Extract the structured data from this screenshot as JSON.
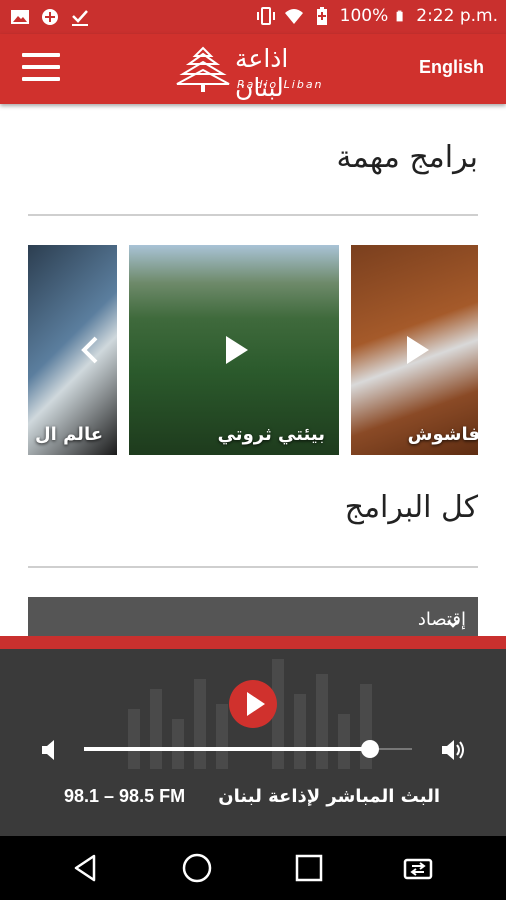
{
  "status_bar": {
    "left_icons": [
      "image-icon",
      "data-saver-icon",
      "download-done-icon"
    ],
    "right_icons": [
      "vibrate-icon",
      "wifi-icon",
      "battery-saver-icon",
      "battery-icon"
    ],
    "battery": "100%",
    "time": "2:22 p.m."
  },
  "header": {
    "logo_arabic": "اذاعة لبنان",
    "logo_latin": "Radio Liban",
    "language_toggle": "English"
  },
  "featured": {
    "title": "برامج مهمة",
    "cards": [
      {
        "label": "عالم ال",
        "icon": "play-icon"
      },
      {
        "label": "بيئتي ثروتي",
        "icon": "play-icon"
      },
      {
        "label": "فاشوش",
        "icon": "play-icon"
      }
    ]
  },
  "all_programs": {
    "title": "كل البرامج",
    "category": "إقتصاد"
  },
  "player": {
    "live_text": "البث المباشر لإذاعة لبنان",
    "frequencies": "98.1 – 98.5 FM",
    "volume": 0.8
  },
  "colors": {
    "brand_red": "#d0312d",
    "player_bg": "#3a3a3a"
  }
}
